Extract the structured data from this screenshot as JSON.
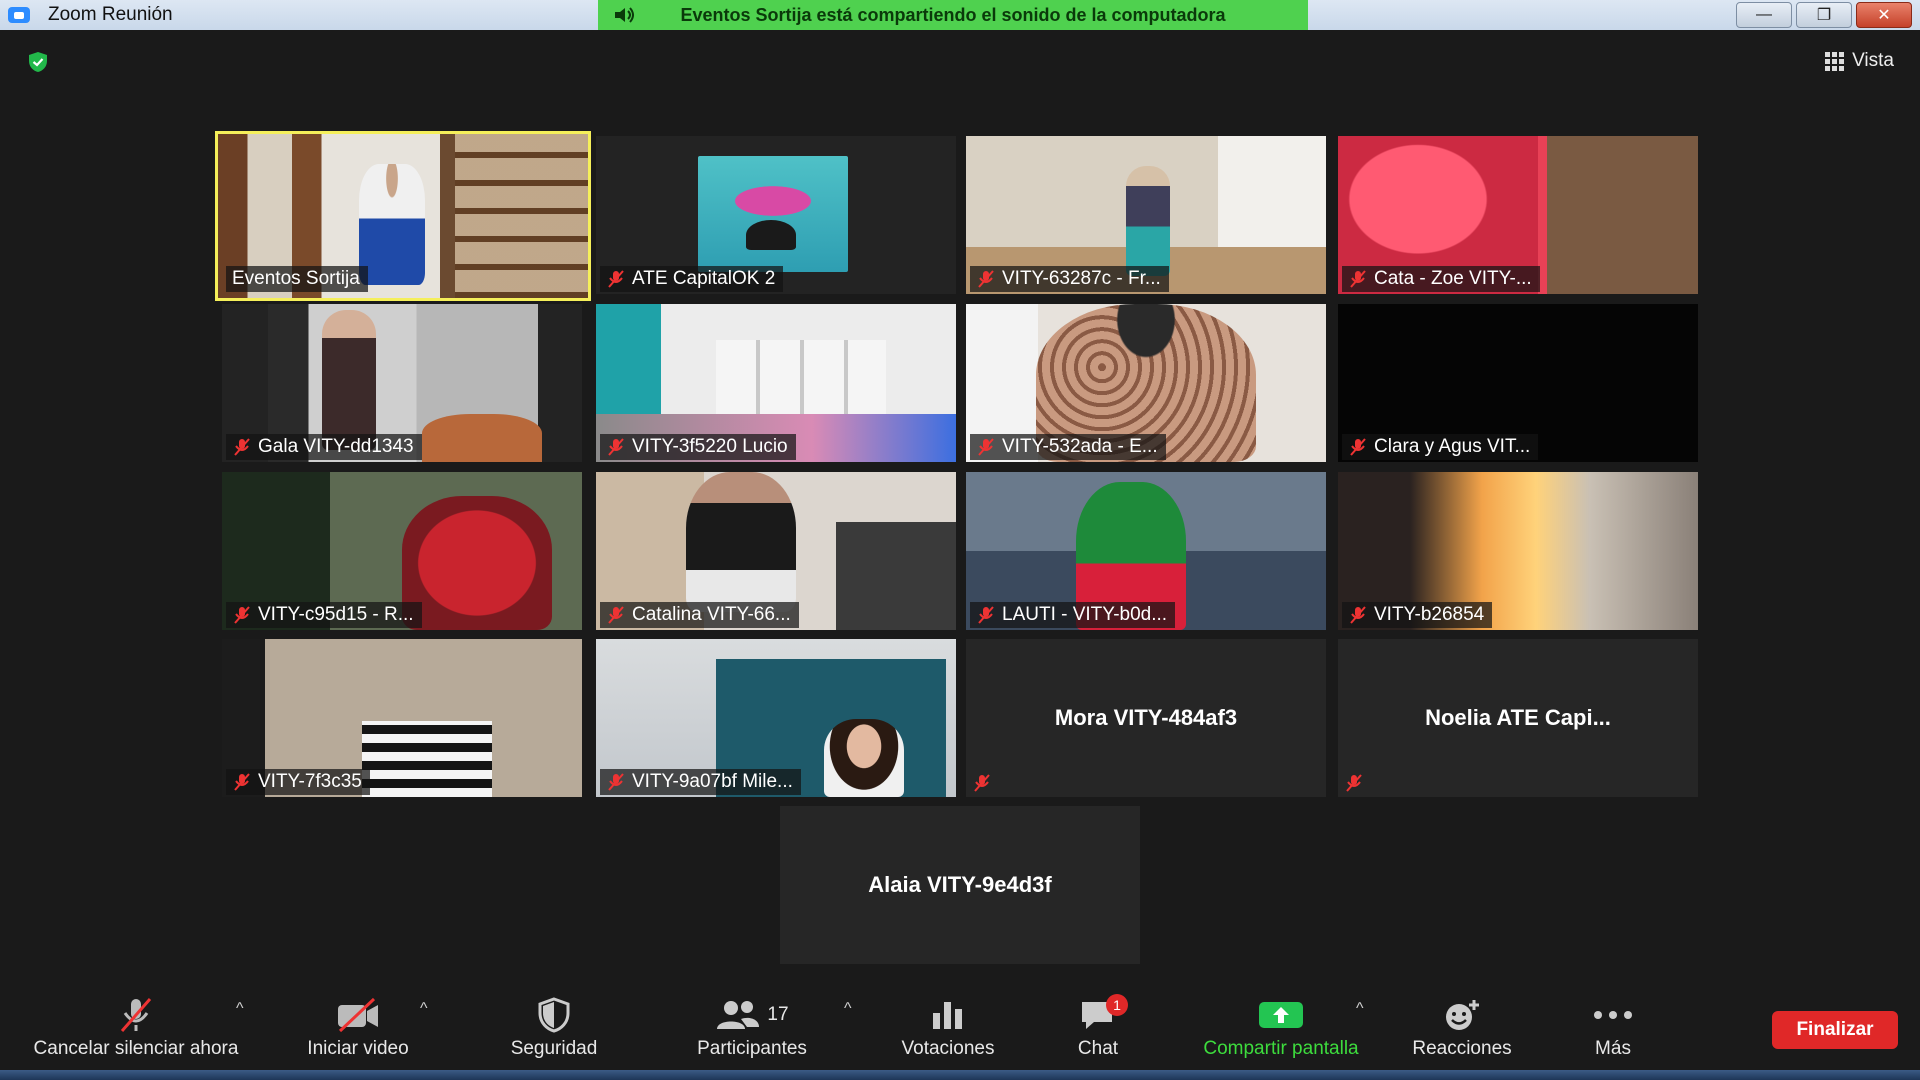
{
  "window": {
    "title": "Zoom Reunión",
    "share_banner": "Eventos Sortija está compartiendo el sonido de la computadora",
    "minimize_glyph": "—",
    "restore_glyph": "❐",
    "close_glyph": "✕"
  },
  "view": {
    "label": "Vista"
  },
  "tiles": [
    {
      "name": "Eventos Sortija",
      "muted": false,
      "active": true
    },
    {
      "name": "ATE CapitalOK 2",
      "muted": true
    },
    {
      "name": "VITY-63287c - Fr...",
      "muted": true
    },
    {
      "name": "Cata - Zoe VITY-...",
      "muted": true
    },
    {
      "name": "Gala VITY-dd1343",
      "muted": true
    },
    {
      "name": "VITY-3f5220 Lucio",
      "muted": true
    },
    {
      "name": "VITY-532ada - E...",
      "muted": true
    },
    {
      "name": "Clara y Agus VIT...",
      "muted": true
    },
    {
      "name": "VITY-c95d15 - R...",
      "muted": true
    },
    {
      "name": "Catalina VITY-66...",
      "muted": true
    },
    {
      "name": "LAUTI - VITY-b0d...",
      "muted": true
    },
    {
      "name": "VITY-b26854",
      "muted": true
    },
    {
      "name": "VITY-7f3c35",
      "muted": true
    },
    {
      "name": "VITY-9a07bf Mile...",
      "muted": true
    },
    {
      "name": "Mora VITY-484af3",
      "muted": true,
      "video": false
    },
    {
      "name": "Noelia ATE Capi...",
      "muted": true,
      "video": false
    },
    {
      "name": "Alaia VITY-9e4d3f",
      "muted": false,
      "video": false
    }
  ],
  "toolbar": {
    "unmute": "Cancelar silenciar ahora",
    "video": "Iniciar video",
    "security": "Seguridad",
    "participants": "Participantes",
    "participants_count": "17",
    "polls": "Votaciones",
    "chat": "Chat",
    "chat_badge": "1",
    "share": "Compartir pantalla",
    "reactions": "Reacciones",
    "more": "Más",
    "end": "Finalizar",
    "caret": "^"
  },
  "colors": {
    "share_green": "#3ddc3d",
    "banner_green": "#4fd14f",
    "end_red": "#e02828",
    "active_border": "#f5ef5a"
  }
}
